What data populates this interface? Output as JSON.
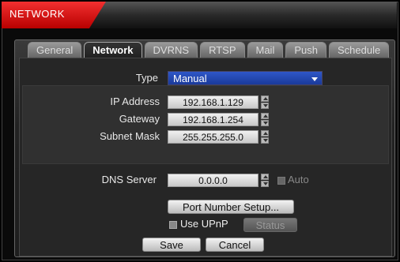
{
  "title": "NETWORK",
  "tabs": [
    "General",
    "Network",
    "DVRNS",
    "RTSP",
    "Mail",
    "Push",
    "Schedule"
  ],
  "active_tab": "Network",
  "type": {
    "label": "Type",
    "value": "Manual"
  },
  "ip": {
    "label": "IP Address",
    "value": "192.168.1.129"
  },
  "gateway": {
    "label": "Gateway",
    "value": "192.168.1.254"
  },
  "subnet": {
    "label": "Subnet Mask",
    "value": "255.255.255.0"
  },
  "dns": {
    "label": "DNS Server",
    "value": "0.0.0.0",
    "auto_label": "Auto"
  },
  "port_button": "Port Number Setup...",
  "upnp": {
    "label": "Use UPnP",
    "status_button": "Status"
  },
  "save_button": "Save",
  "cancel_button": "Cancel"
}
